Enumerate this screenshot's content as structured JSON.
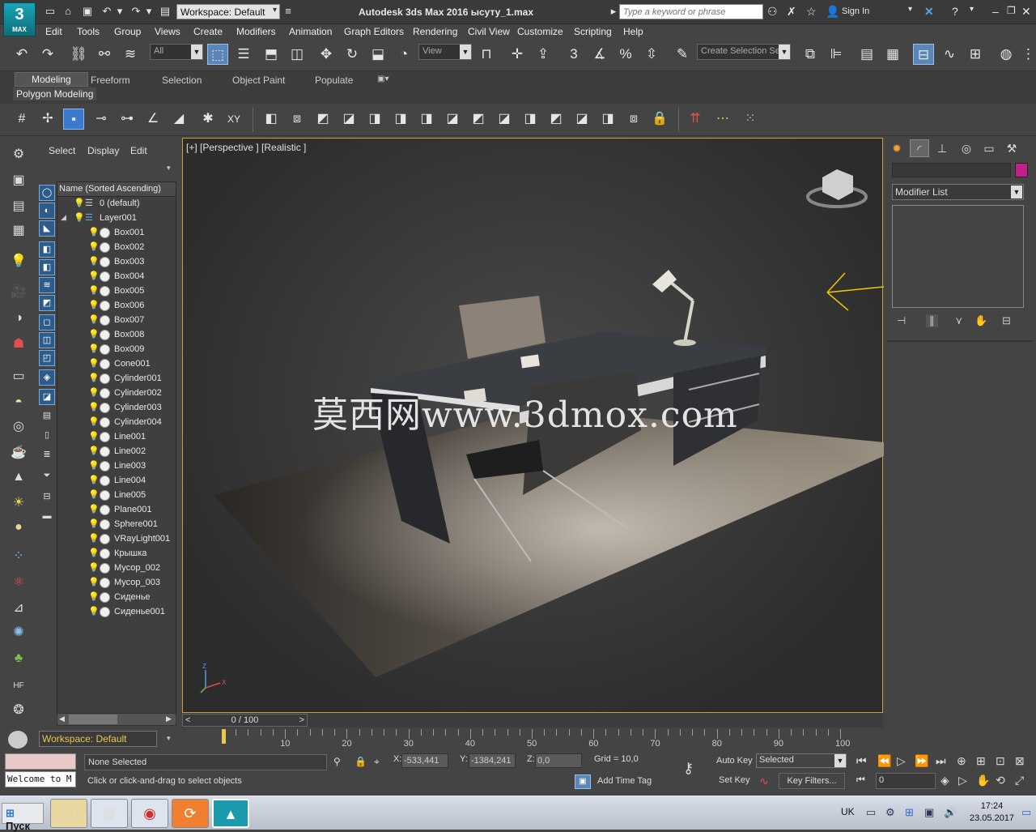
{
  "app": {
    "logo_big": "3",
    "logo_small": "MAX",
    "title": "Autodesk 3ds Max 2016     ысуту_1.max",
    "workspace": "Workspace: Default",
    "search_placeholder": "Type a keyword or phrase",
    "sign_in": "Sign In"
  },
  "menu": [
    "Edit",
    "Tools",
    "Group",
    "Views",
    "Create",
    "Modifiers",
    "Animation",
    "Graph Editors",
    "Rendering",
    "Civil View",
    "Customize",
    "Scripting",
    "Help"
  ],
  "toolbar": {
    "filter": "All",
    "ref_coord": "View",
    "selection_set": "Create Selection Se"
  },
  "ribbon": {
    "tabs": [
      "Modeling",
      "Freeform",
      "Selection",
      "Object Paint",
      "Populate"
    ],
    "panel": "Polygon Modeling"
  },
  "explorer": {
    "tabs": [
      "Select",
      "Display",
      "Edit"
    ],
    "column_header": "Name (Sorted Ascending)",
    "layers": [
      {
        "name": "0 (default)"
      },
      {
        "name": "Layer001"
      }
    ],
    "objects": [
      "Box001",
      "Box002",
      "Box003",
      "Box004",
      "Box005",
      "Box006",
      "Box007",
      "Box008",
      "Box009",
      "Cone001",
      "Cylinder001",
      "Cylinder002",
      "Cylinder003",
      "Cylinder004",
      "Line001",
      "Line002",
      "Line003",
      "Line004",
      "Line005",
      "Plane001",
      "Sphere001",
      "VRayLight001",
      "Крышка",
      "Мусор_002",
      "Мусор_003",
      "Сиденье",
      "Сиденье001"
    ]
  },
  "viewport": {
    "label": "[+] [Perspective ] [Realistic ]",
    "watermark": "莫西网www.3dmox.com",
    "axis_labels": [
      "Z",
      "X"
    ]
  },
  "command_panel": {
    "modifier_list": "Modifier List",
    "color_swatch": "#c0208a"
  },
  "timeline": {
    "frame_display": "0 / 100",
    "ticks": [
      "10",
      "20",
      "30",
      "40",
      "50",
      "60",
      "70",
      "80",
      "90",
      "100"
    ],
    "workspace": "Workspace: Default"
  },
  "status": {
    "selection": "None Selected",
    "prompt": "Click or click-and-drag to select objects",
    "script_listener": "Welcome to M",
    "x_label": "X:",
    "x": "-533,441",
    "y_label": "Y:",
    "y": "-1384,241",
    "z_label": "Z:",
    "z": "0,0",
    "grid": "Grid = 10,0",
    "add_time_tag": "Add Time Tag",
    "auto_key": "Auto Key",
    "set_key": "Set Key",
    "key_mode": "Selected",
    "key_filters": "Key Filters...",
    "current_frame": "0"
  },
  "taskbar": {
    "start": "Пуск",
    "language": "UK",
    "time": "17:24",
    "date": "23.05.2017",
    "apps": [
      "file-explorer-icon",
      "calculator-icon",
      "chrome-icon",
      "pdf-icon",
      "3dsmax-icon"
    ]
  }
}
